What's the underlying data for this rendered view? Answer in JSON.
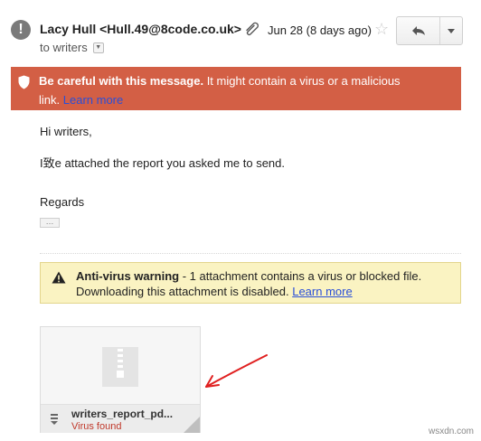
{
  "header": {
    "sender": "Lacy Hull <Hull.49@8code.co.uk>",
    "to_label": "to writers",
    "date": "Jun 28 (8 days ago)",
    "icons": {
      "avatar": "warning-exclamation-icon",
      "attachment": "paperclip-icon",
      "star": "star-icon",
      "reply": "reply-arrow-icon",
      "more": "dropdown-caret-icon"
    }
  },
  "danger_banner": {
    "title": "Be careful with this message.",
    "text_line1": " It might contain a virus or a malicious",
    "text_line2": "link.",
    "learn_more": "Learn more",
    "color": "#d35f45"
  },
  "message": {
    "greeting": "Hi writers,",
    "line1": "I致e attached the report you asked me to send.",
    "signoff": "Regards",
    "ellipsis": "…"
  },
  "antivirus": {
    "title": "Anti-virus warning",
    "text_line1": " - 1 attachment contains a virus or blocked file.",
    "text_line2": "Downloading this attachment is disabled.",
    "learn_more": "Learn more",
    "background": "#faf3c2"
  },
  "attachment": {
    "name": "writers_report_pd...",
    "status": "Virus found",
    "status_color": "#c0392b",
    "icon": "zip-file-icon"
  },
  "annotation": {
    "color": "#e02020"
  },
  "watermark": "wsxdn.com"
}
